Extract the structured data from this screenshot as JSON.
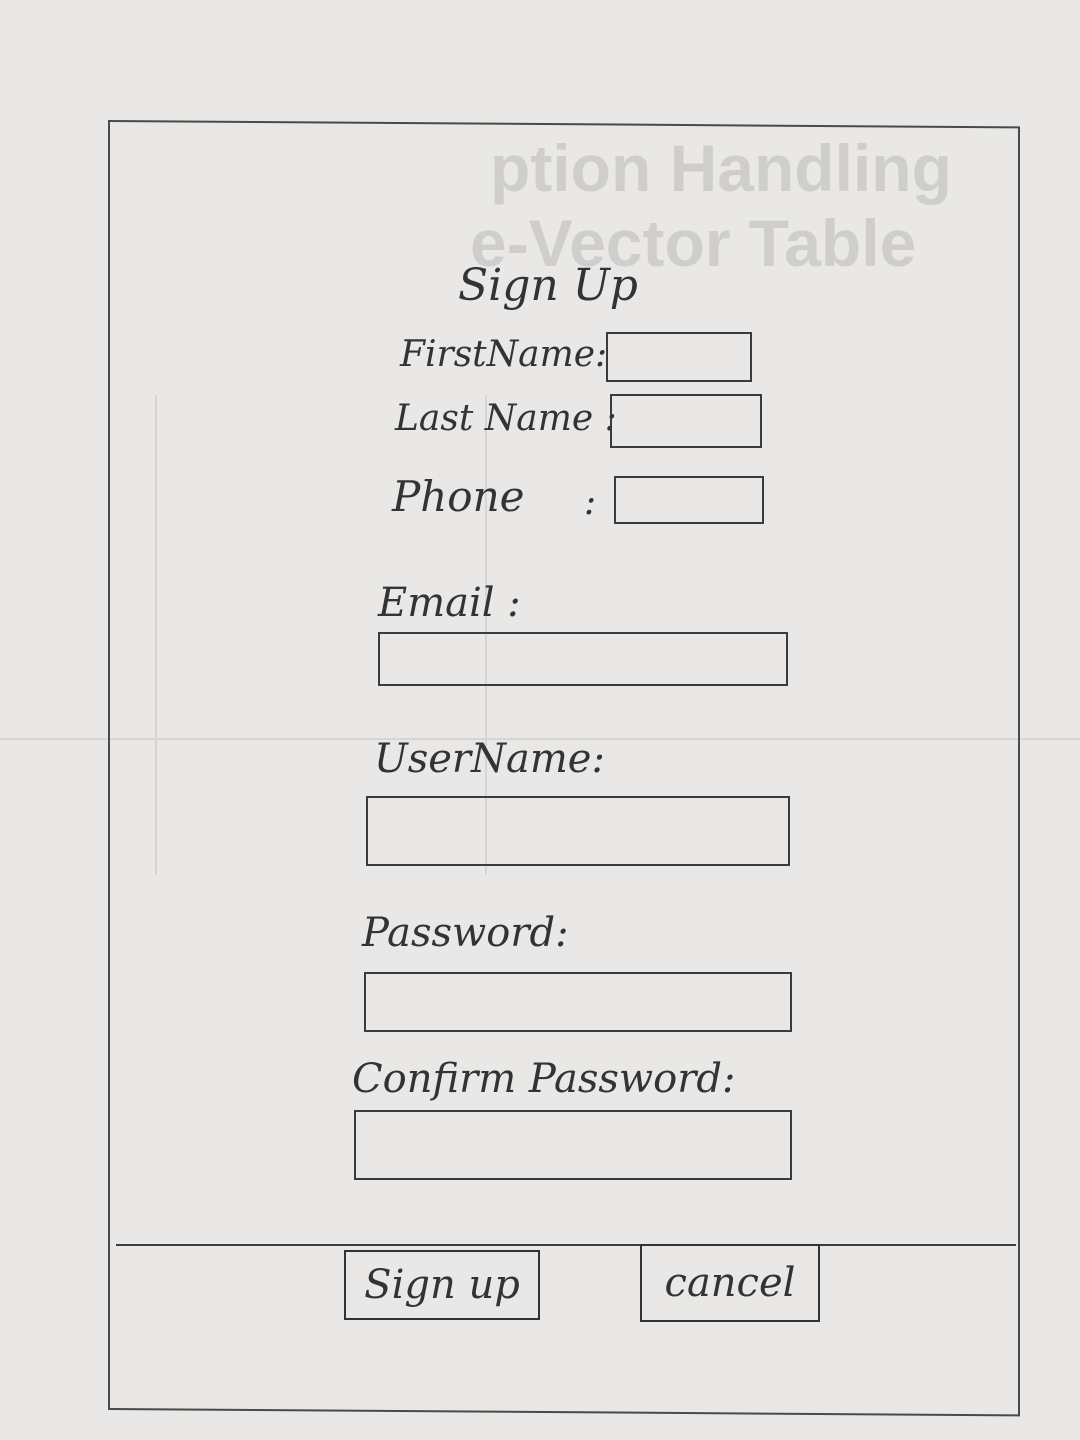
{
  "form": {
    "title": "Sign Up",
    "first_name_label": "FirstName:",
    "last_name_label": "Last Name :",
    "phone_label": "Phone",
    "phone_colon": ":",
    "email_label": "Email :",
    "username_label": "UserName:",
    "password_label": "Password:",
    "confirm_password_label": "Confirm Password:",
    "first_name_value": "",
    "last_name_value": "",
    "phone_value": "",
    "email_value": "",
    "username_value": "",
    "password_value": "",
    "confirm_password_value": ""
  },
  "footer": {
    "signup_label": "Sign up",
    "cancel_label": "cancel"
  },
  "background_text": {
    "line1": "ption Handling",
    "line2": "e-Vector Table"
  }
}
